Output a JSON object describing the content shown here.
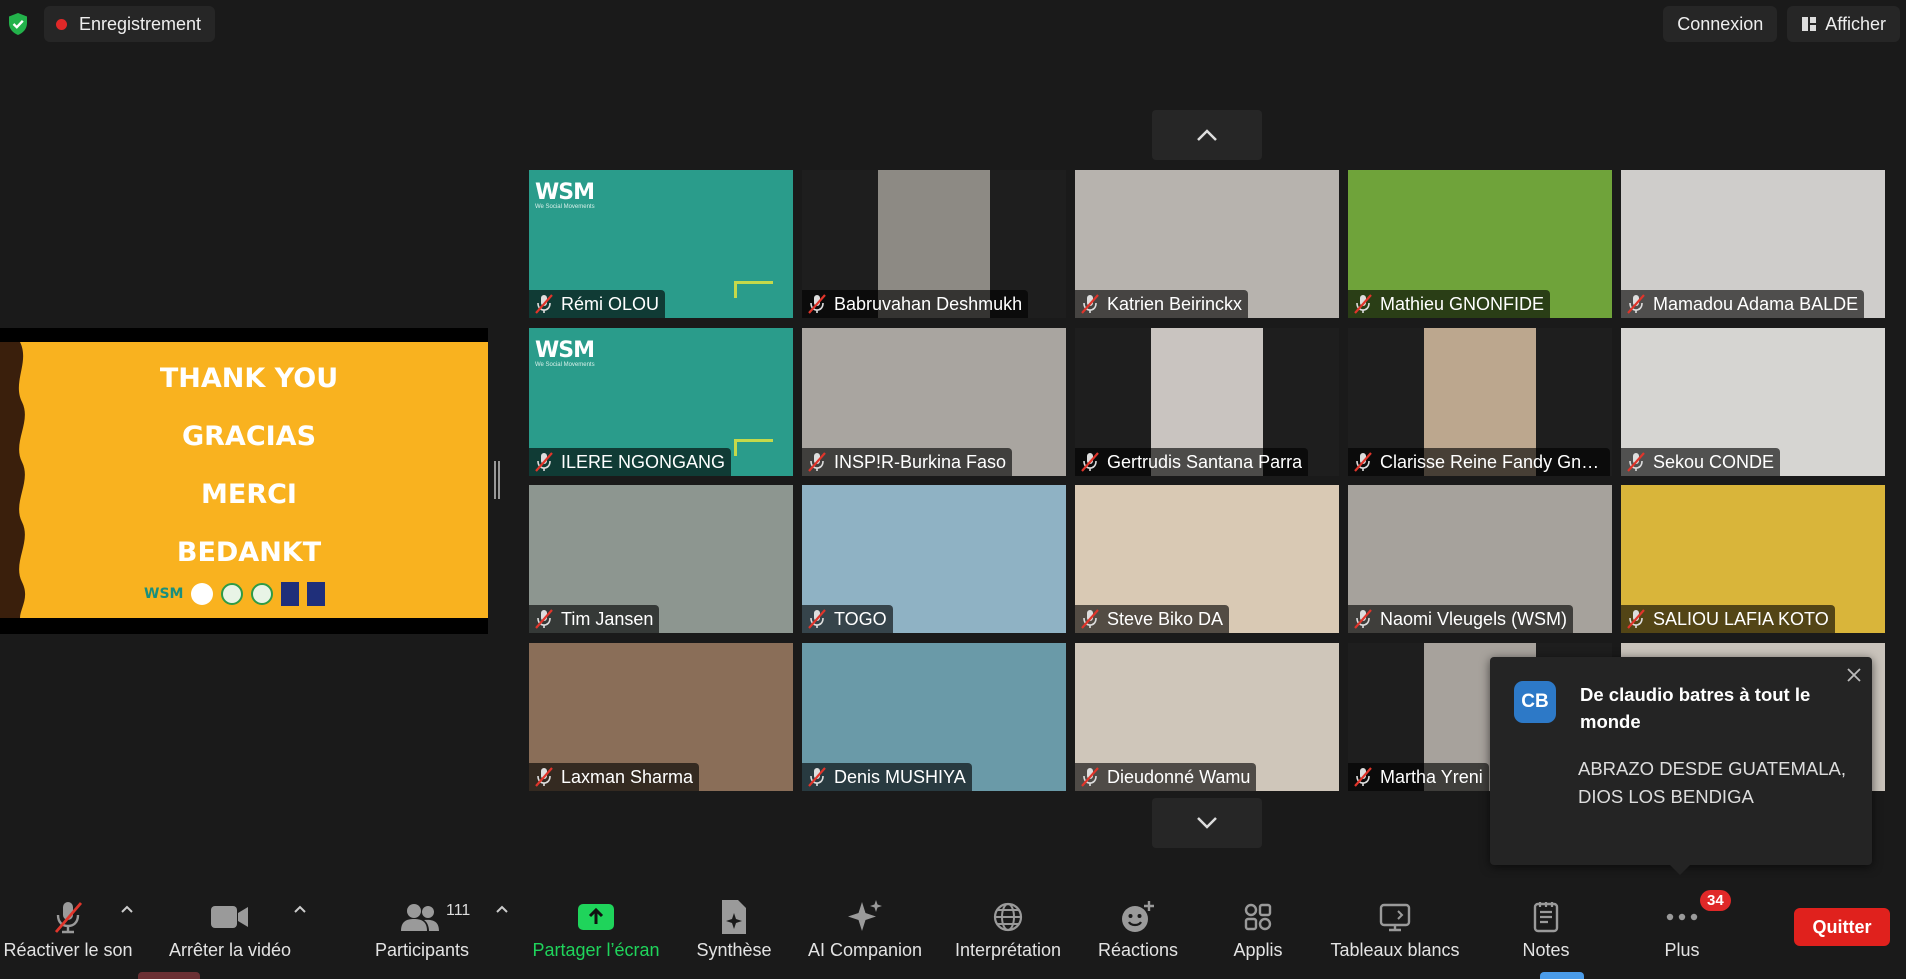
{
  "header": {
    "recording_label": "Enregistrement",
    "connect_label": "Connexion",
    "view_label": "Afficher"
  },
  "shared_slide": {
    "lines": [
      "THANK YOU",
      "GRACIAS",
      "MERCI",
      "BEDANKT"
    ],
    "logo_text": "WSM"
  },
  "gallery": {
    "tiles": [
      {
        "name": "Rémi OLOU",
        "bg": "#2a9c8b",
        "logo": "WSM",
        "logo_sub": "We Social Movements"
      },
      {
        "name": "Babruvahan Deshmukh",
        "bg": "#1e1e1e",
        "video": "#8d8a84"
      },
      {
        "name": "Katrien Beirinckx",
        "bg": "#b7b3ae"
      },
      {
        "name": "Mathieu GNONFIDE",
        "bg": "#6fa33a"
      },
      {
        "name": "Mamadou Adama BALDE",
        "bg": "#cfcdcb"
      },
      {
        "name": "ILERE NGONGANG",
        "bg": "#2a9c8b",
        "logo": "WSM",
        "logo_sub": "We Social Movements"
      },
      {
        "name": "INSP!R-Burkina Faso",
        "bg": "#a9a5a0"
      },
      {
        "name": "Gertrudis Santana Parra",
        "bg": "#1e1e1e",
        "video": "#c9c4c0"
      },
      {
        "name": "Clarisse Reine Fandy Gna...",
        "bg": "#1e1e1e",
        "video": "#bca78e"
      },
      {
        "name": "Sekou CONDE",
        "bg": "#d6d5d2"
      },
      {
        "name": "Tim Jansen",
        "bg": "#8d9690"
      },
      {
        "name": "TOGO",
        "bg": "#8fb2c4"
      },
      {
        "name": "Steve Biko DA",
        "bg": "#d9c9b4"
      },
      {
        "name": "Naomi Vleugels (WSM)",
        "bg": "#a6a29c"
      },
      {
        "name": "SALIOU LAFIA KOTO",
        "bg": "#d9b53a"
      },
      {
        "name": "Laxman Sharma",
        "bg": "#8a6e58"
      },
      {
        "name": "Denis MUSHIYA",
        "bg": "#6a9aa8"
      },
      {
        "name": "Dieudonné Wamu",
        "bg": "#cfc6ba"
      },
      {
        "name": "Martha Yreni",
        "bg": "#1e1e1e",
        "video": "#a7a29c"
      },
      {
        "name": "",
        "bg": "#c9c3bb"
      }
    ]
  },
  "chat_toast": {
    "avatar": "CB",
    "title": "De claudio batres à tout le monde",
    "message": "ABRAZO DESDE GUATEMALA, DIOS LOS BENDIGA"
  },
  "toolbar": {
    "unmute": "Réactiver le son",
    "stop_video": "Arrêter la vidéo",
    "participants": "Participants",
    "participants_count": "111",
    "share": "Partager l’écran",
    "summary": "Synthèse",
    "ai": "AI Companion",
    "interpretation": "Interprétation",
    "reactions": "Réactions",
    "apps": "Applis",
    "whiteboards": "Tableaux blancs",
    "notes": "Notes",
    "more": "Plus",
    "more_badge": "34",
    "quit": "Quitter"
  },
  "colors": {
    "background": "#1a1a1a",
    "share_green": "#1fd45b",
    "quit_red": "#e0211d",
    "slide_yellow": "#f9b21f"
  }
}
